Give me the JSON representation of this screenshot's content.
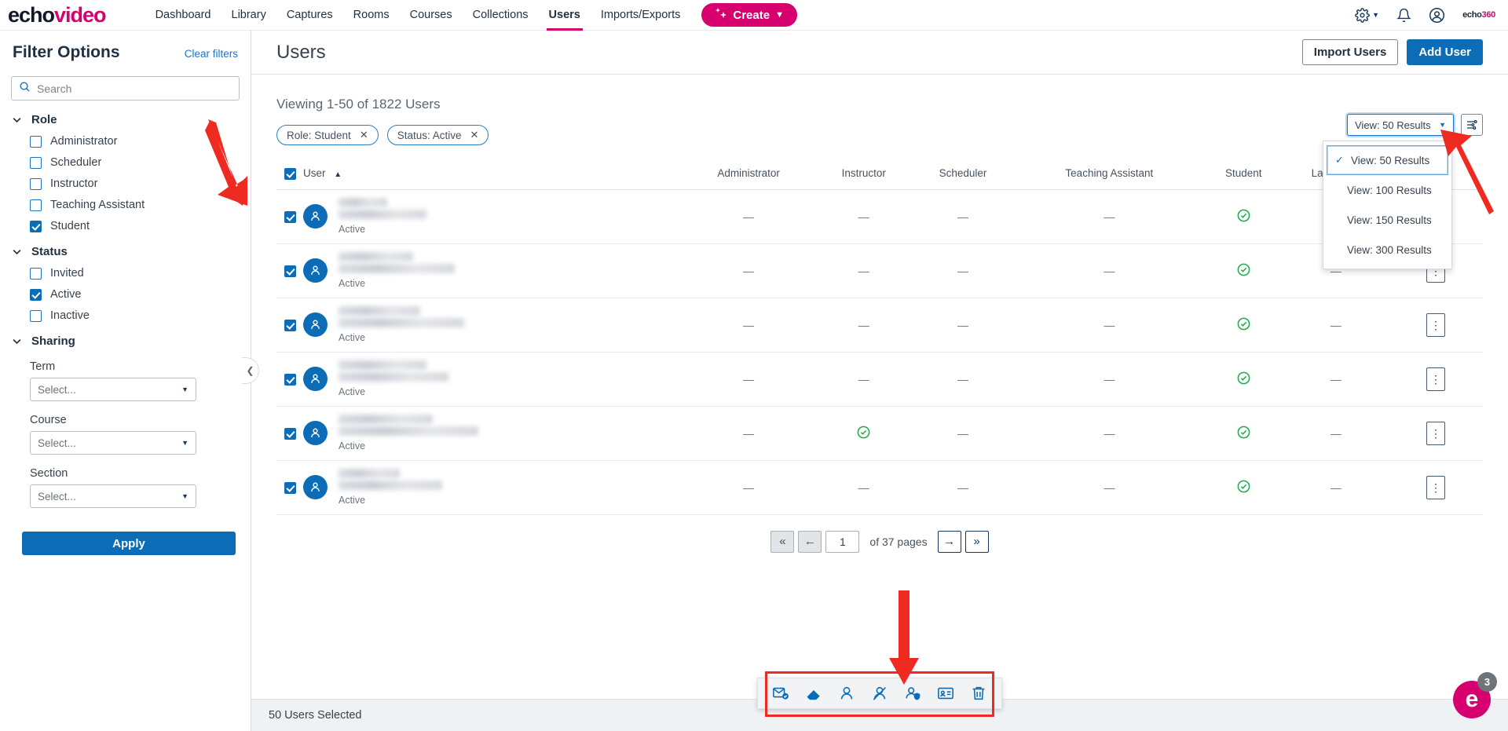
{
  "brand": {
    "logo_echo": "echo",
    "logo_video": "video",
    "mini_logo_a": "echo",
    "mini_logo_b": "360",
    "accent": "#d6006e",
    "primary": "#0c6cb5",
    "success": "#1fa94a",
    "arrow_red": "#ef2a21"
  },
  "topnav": {
    "links": [
      {
        "label": "Dashboard",
        "active": false
      },
      {
        "label": "Library",
        "active": false
      },
      {
        "label": "Captures",
        "active": false
      },
      {
        "label": "Rooms",
        "active": false
      },
      {
        "label": "Courses",
        "active": false
      },
      {
        "label": "Collections",
        "active": false
      },
      {
        "label": "Users",
        "active": true
      },
      {
        "label": "Imports/Exports",
        "active": false
      }
    ],
    "create_label": "Create",
    "icons": [
      "gear-icon",
      "bell-icon",
      "account-icon",
      "echo360-logo"
    ]
  },
  "sidebar": {
    "title": "Filter Options",
    "clear_filters": "Clear filters",
    "search_placeholder": "Search",
    "search_value": "",
    "groups": [
      {
        "name": "Role",
        "options": [
          {
            "label": "Administrator",
            "checked": false
          },
          {
            "label": "Scheduler",
            "checked": false
          },
          {
            "label": "Instructor",
            "checked": false
          },
          {
            "label": "Teaching Assistant",
            "checked": false
          },
          {
            "label": "Student",
            "checked": true
          }
        ]
      },
      {
        "name": "Status",
        "options": [
          {
            "label": "Invited",
            "checked": false
          },
          {
            "label": "Active",
            "checked": true
          },
          {
            "label": "Inactive",
            "checked": false
          }
        ]
      }
    ],
    "sharing": {
      "name": "Sharing",
      "fields": [
        {
          "label": "Term",
          "value": "Select..."
        },
        {
          "label": "Course",
          "value": "Select..."
        },
        {
          "label": "Section",
          "value": "Select..."
        }
      ]
    },
    "apply_label": "Apply"
  },
  "page": {
    "title": "Users",
    "import_users_label": "Import Users",
    "add_user_label": "Add User",
    "viewing": "Viewing 1-50 of 1822 Users",
    "chips": [
      {
        "label": "Role: Student"
      },
      {
        "label": "Status: Active"
      }
    ]
  },
  "view_control": {
    "selected": "View: 50 Results",
    "options": [
      {
        "label": "View: 50 Results",
        "checked": true
      },
      {
        "label": "View: 100 Results",
        "checked": false
      },
      {
        "label": "View: 150 Results",
        "checked": false
      },
      {
        "label": "View: 300 Results",
        "checked": false
      }
    ],
    "settings_icon": "table-settings-icon"
  },
  "table": {
    "select_all_checked": true,
    "columns": [
      "User",
      "Administrator",
      "Instructor",
      "Scheduler",
      "Teaching Assistant",
      "Student",
      "Last Login",
      ""
    ],
    "sort_column": "User",
    "sort_direction": "asc",
    "rows": [
      {
        "checked": true,
        "status": "Active",
        "name_widths": [
          62,
          112
        ],
        "administrator": "—",
        "instructor": "—",
        "scheduler": "—",
        "teaching_assistant": "—",
        "student": "check",
        "last_login": "—"
      },
      {
        "checked": true,
        "status": "Active",
        "name_widths": [
          95,
          148
        ],
        "administrator": "—",
        "instructor": "—",
        "scheduler": "—",
        "teaching_assistant": "—",
        "student": "check",
        "last_login": "—"
      },
      {
        "checked": true,
        "status": "Active",
        "name_widths": [
          104,
          160
        ],
        "administrator": "—",
        "instructor": "—",
        "scheduler": "—",
        "teaching_assistant": "—",
        "student": "check",
        "last_login": "—"
      },
      {
        "checked": true,
        "status": "Active",
        "name_widths": [
          112,
          140
        ],
        "administrator": "—",
        "instructor": "—",
        "scheduler": "—",
        "teaching_assistant": "—",
        "student": "check",
        "last_login": "—"
      },
      {
        "checked": true,
        "status": "Active",
        "name_widths": [
          120,
          178
        ],
        "administrator": "—",
        "instructor": "check",
        "scheduler": "—",
        "teaching_assistant": "—",
        "student": "check",
        "last_login": "—"
      },
      {
        "checked": true,
        "status": "Active",
        "name_widths": [
          78,
          132
        ],
        "administrator": "—",
        "instructor": "—",
        "scheduler": "—",
        "teaching_assistant": "—",
        "student": "check",
        "last_login": "—"
      }
    ]
  },
  "pagination": {
    "first_label": "«",
    "prev_label": "←",
    "page_value": "1",
    "of_label": "of 37 pages",
    "next_label": "→",
    "last_label": "»"
  },
  "bulk_actions": {
    "icons": [
      "email-check-icon",
      "eraser-icon",
      "user-icon",
      "user-remove-icon",
      "user-shield-icon",
      "id-card-icon",
      "trash-icon"
    ]
  },
  "footer": {
    "selection_text": "50 Users Selected"
  },
  "help_widget": {
    "letter": "e",
    "badge": "3"
  }
}
